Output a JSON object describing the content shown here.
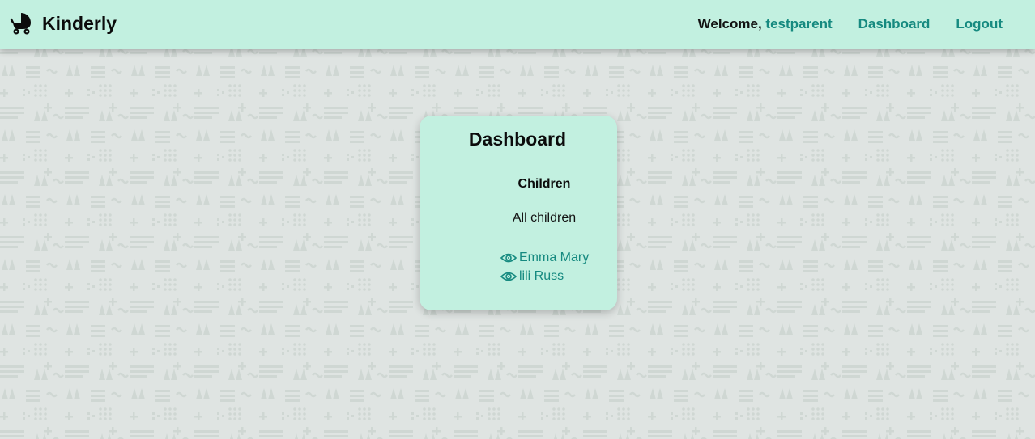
{
  "app": {
    "brand_name": "Kinderly",
    "brand_icon": "baby-stroller-icon"
  },
  "header": {
    "welcome_prefix": "Welcome,",
    "username": "testparent",
    "nav": {
      "dashboard_label": "Dashboard",
      "logout_label": "Logout"
    }
  },
  "dashboard": {
    "title": "Dashboard",
    "section_title": "Children",
    "section_subtitle": "All children",
    "children": [
      {
        "name": "Emma Mary",
        "icon": "eye-icon"
      },
      {
        "name": "lili Russ",
        "icon": "eye-icon"
      }
    ]
  },
  "colors": {
    "header_bg": "#c2f0e0",
    "card_bg": "#c2f0e0",
    "accent": "#168a80",
    "page_bg": "#dfe4e2",
    "pattern": "#cdd5d2"
  }
}
